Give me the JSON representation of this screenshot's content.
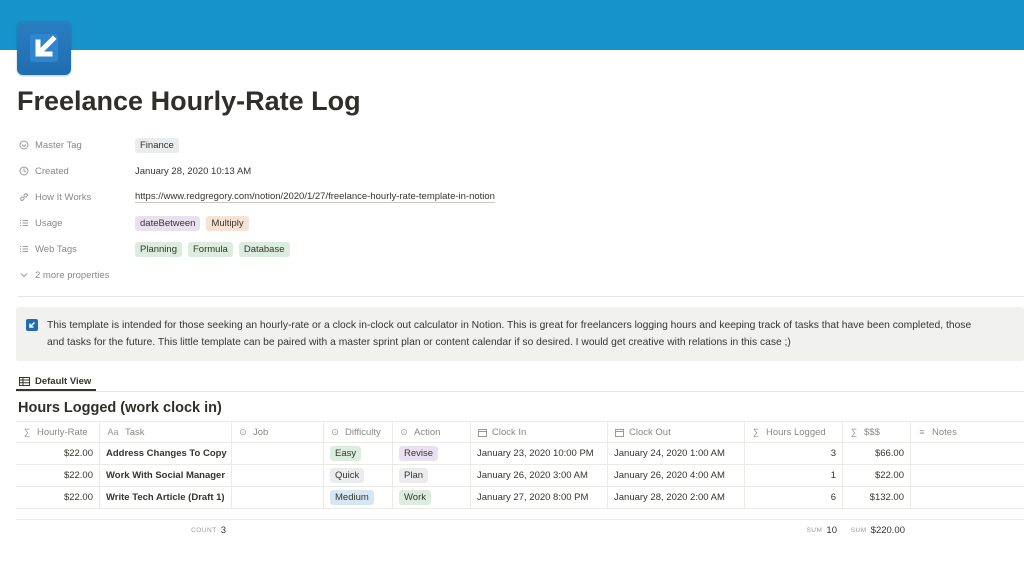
{
  "page": {
    "title": "Freelance Hourly-Rate Log",
    "icon": "arrow-down-left-icon",
    "banner_color": "#1793cc"
  },
  "properties": {
    "master_tag": {
      "name": "Master Tag",
      "tags": [
        "Finance"
      ]
    },
    "created": {
      "name": "Created",
      "value": "January 28, 2020 10:13 AM"
    },
    "how_it_works": {
      "name": "How It Works",
      "value": "https://www.redgregory.com/notion/2020/1/27/freelance-hourly-rate-template-in-notion"
    },
    "usage": {
      "name": "Usage",
      "tags": [
        "dateBetween",
        "Multiply"
      ]
    },
    "web_tags": {
      "name": "Web Tags",
      "tags": [
        "Planning",
        "Formula",
        "Database"
      ]
    },
    "more": "2 more properties"
  },
  "callout": {
    "line1": "This template is intended for those seeking an hourly-rate or a clock in-clock out calculator in Notion. This is great for freelancers logging hours and keeping track of tasks that have been completed, those",
    "line2": "and tasks for the future.  This little template can be paired with a master sprint plan or content calendar if so desired. I would get creative with relations in this case ;)"
  },
  "view": {
    "label": "Default View"
  },
  "database": {
    "title": "Hours Logged (work clock in)",
    "columns": [
      "Hourly-Rate",
      "Task",
      "Job",
      "Difficulty",
      "Action",
      "Clock In",
      "Clock Out",
      "Hours Logged",
      "$$$",
      "Notes"
    ],
    "rows": [
      {
        "rate": "$22.00",
        "task": "Address Changes To Copy",
        "job": "",
        "difficulty": "Easy",
        "action": "Revise",
        "clock_in": "January 23, 2020 10:00 PM",
        "clock_out": "January 24, 2020 1:00 AM",
        "hours": "3",
        "amount": "$66.00",
        "notes": ""
      },
      {
        "rate": "$22.00",
        "task": "Work With Social Manager",
        "job": "",
        "difficulty": "Quick",
        "action": "Plan",
        "clock_in": "January 26, 2020 3:00 AM",
        "clock_out": "January 26, 2020 4:00 AM",
        "hours": "1",
        "amount": "$22.00",
        "notes": ""
      },
      {
        "rate": "$22.00",
        "task": "Write Tech Article (Draft 1)",
        "job": "",
        "difficulty": "Medium",
        "action": "Work",
        "clock_in": "January 27, 2020 8:00 PM",
        "clock_out": "January 28, 2020 2:00 AM",
        "hours": "6",
        "amount": "$132.00",
        "notes": ""
      }
    ],
    "footer": {
      "count_label": "COUNT",
      "count_value": "3",
      "hours_label": "SUM",
      "hours_value": "10",
      "amount_label": "SUM",
      "amount_value": "$220.00"
    }
  }
}
